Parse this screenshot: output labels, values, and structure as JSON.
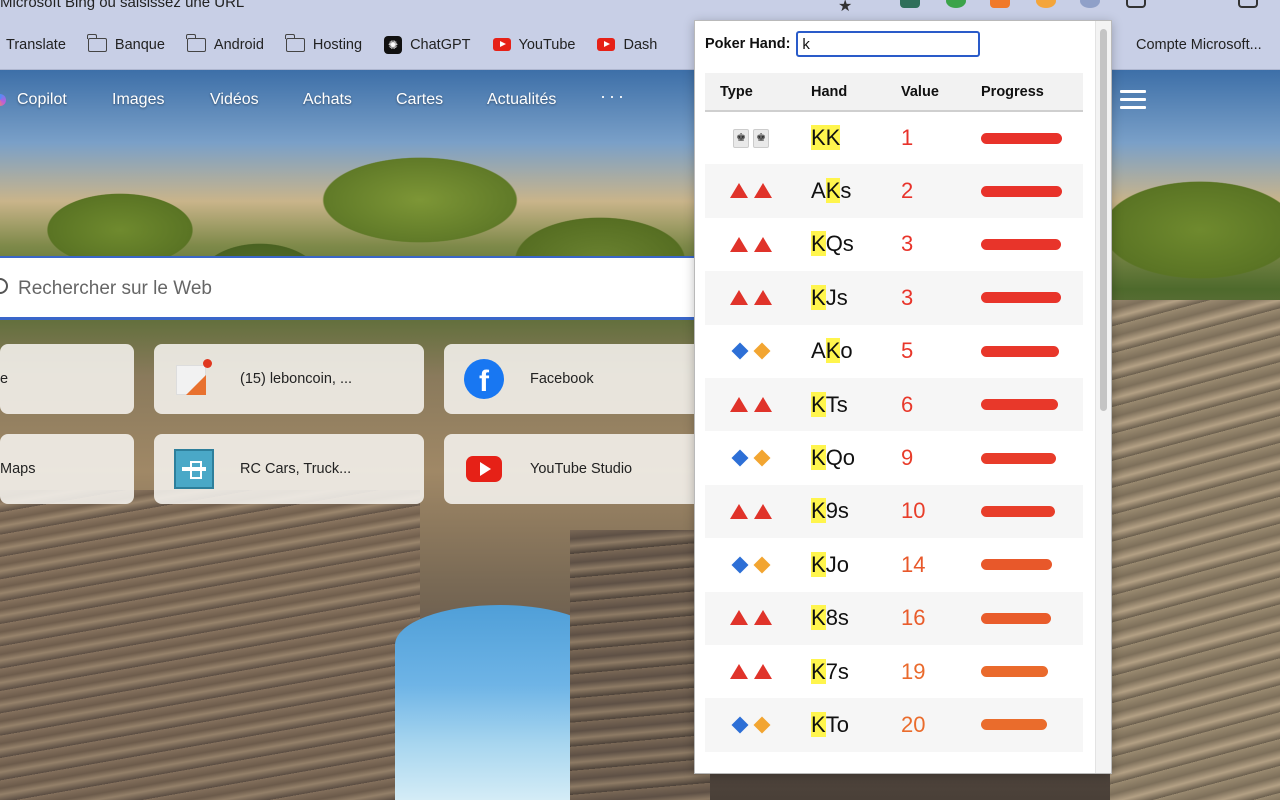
{
  "browser": {
    "url_text": "Microsoft Bing ou saisissez une URL",
    "bookmarks": [
      {
        "label": "Translate",
        "icon": "translate-icon"
      },
      {
        "label": "Banque",
        "icon": "folder-icon"
      },
      {
        "label": "Android",
        "icon": "folder-icon"
      },
      {
        "label": "Hosting",
        "icon": "folder-icon"
      },
      {
        "label": "ChatGPT",
        "icon": "chatgpt-icon"
      },
      {
        "label": "YouTube",
        "icon": "youtube-icon"
      },
      {
        "label": "Dash",
        "icon": "youtube-icon"
      }
    ],
    "bookmark_right": "Compte Microsoft..."
  },
  "bing": {
    "nav": [
      "Copilot",
      "Images",
      "Vidéos",
      "Achats",
      "Cartes",
      "Actualités"
    ],
    "more": "···",
    "search_placeholder": "Rechercher sur le Web",
    "tiles": [
      {
        "label": "e"
      },
      {
        "label": "(15) leboncoin, ..."
      },
      {
        "label": "Facebook"
      },
      {
        "label": "Maps"
      },
      {
        "label": "RC Cars, Truck..."
      },
      {
        "label": "YouTube Studio"
      }
    ]
  },
  "popup": {
    "search_label": "Poker Hand:",
    "search_value": "k",
    "columns": {
      "type": "Type",
      "hand": "Hand",
      "value": "Value",
      "progress": "Progress"
    },
    "rows": [
      {
        "type": "pair",
        "pre": "",
        "hl": "KK",
        "post": "",
        "value": "1",
        "color": "#e8322a",
        "progress": 0.97
      },
      {
        "type": "suited",
        "pre": "A",
        "hl": "K",
        "post": "s",
        "value": "2",
        "color": "#e8322a",
        "progress": 0.96
      },
      {
        "type": "suited",
        "pre": "",
        "hl": "K",
        "post": "Qs",
        "value": "3",
        "color": "#e8342a",
        "progress": 0.95
      },
      {
        "type": "suited",
        "pre": "",
        "hl": "K",
        "post": "Js",
        "value": "3",
        "color": "#e8342a",
        "progress": 0.95
      },
      {
        "type": "offsuit",
        "pre": "A",
        "hl": "K",
        "post": "o",
        "value": "5",
        "color": "#e8362a",
        "progress": 0.93
      },
      {
        "type": "suited",
        "pre": "",
        "hl": "K",
        "post": "Ts",
        "value": "6",
        "color": "#e8382a",
        "progress": 0.92
      },
      {
        "type": "offsuit",
        "pre": "",
        "hl": "K",
        "post": "Qo",
        "value": "9",
        "color": "#e83c2a",
        "progress": 0.89
      },
      {
        "type": "suited",
        "pre": "",
        "hl": "K",
        "post": "9s",
        "value": "10",
        "color": "#e83e2a",
        "progress": 0.88
      },
      {
        "type": "offsuit",
        "pre": "",
        "hl": "K",
        "post": "Jo",
        "value": "14",
        "color": "#e8582a",
        "progress": 0.85
      },
      {
        "type": "suited",
        "pre": "",
        "hl": "K",
        "post": "8s",
        "value": "16",
        "color": "#e95c2b",
        "progress": 0.83
      },
      {
        "type": "suited",
        "pre": "",
        "hl": "K",
        "post": "7s",
        "value": "19",
        "color": "#ea6a2c",
        "progress": 0.8
      },
      {
        "type": "offsuit",
        "pre": "",
        "hl": "K",
        "post": "To",
        "value": "20",
        "color": "#ea6c2c",
        "progress": 0.79
      }
    ]
  }
}
